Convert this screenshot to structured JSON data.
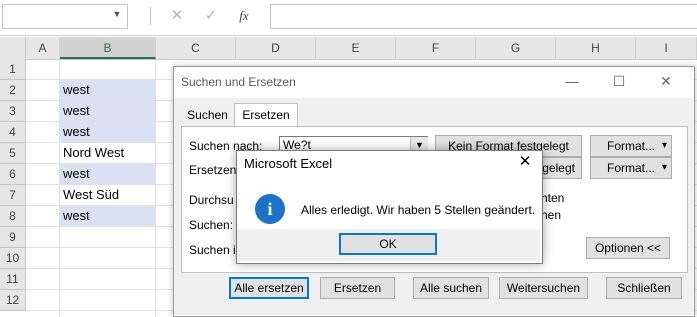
{
  "formula_bar": {
    "icons": [
      "chevron-down-icon",
      "close-icon",
      "check-icon",
      "function-icon"
    ],
    "fx_label": "fx"
  },
  "columns": [
    "A",
    "B",
    "C",
    "D",
    "E",
    "F",
    "G",
    "H",
    "I"
  ],
  "rows": [
    "1",
    "2",
    "3",
    "4",
    "5",
    "6",
    "7",
    "8",
    "9",
    "10",
    "11",
    "12"
  ],
  "cells_b": [
    "",
    "west",
    "west",
    "west",
    "Nord West",
    "west",
    "West Süd",
    "west",
    "",
    "",
    "",
    ""
  ],
  "highlight_color": "#d9e1f2",
  "dialog": {
    "title": "Suchen und Ersetzen",
    "tabs": [
      "Suchen",
      "Ersetzen"
    ],
    "find_label": "Suchen nach:",
    "find_value": "We?t",
    "replace_label": "Ersetzen",
    "no_format_label": "Kein Format festgelegt",
    "no_format_label_2": "gelegt",
    "format_button": "Format...",
    "search_in_label": "Durchsu",
    "search_label": "Suchen:",
    "look_in_label": "Suchen in",
    "option_right_1": "hten",
    "option_right_2": "hen",
    "options_button": "Optionen <<",
    "replace_all_button": "Alle ersetzen",
    "replace_button": "Ersetzen",
    "find_all_button": "Alle suchen",
    "find_next_button": "Weitersuchen",
    "close_button": "Schließen"
  },
  "message_box": {
    "title": "Microsoft Excel",
    "text": "Alles erledigt. Wir haben 5 Stellen geändert.",
    "ok": "OK",
    "icon_glyph": "i",
    "icon_color": "#1a73c9"
  }
}
